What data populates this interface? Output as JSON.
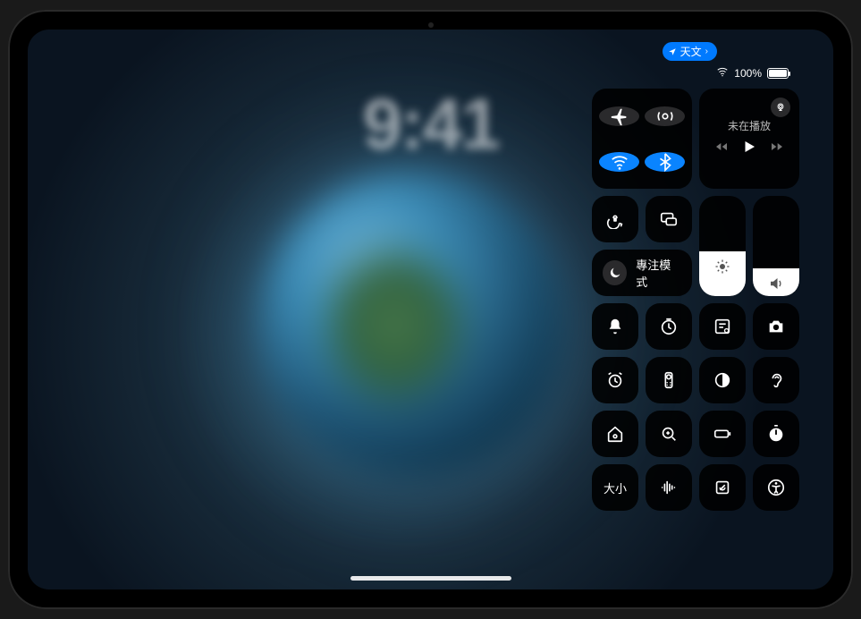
{
  "lock_screen": {
    "time": "9:41"
  },
  "status": {
    "pill_label": "天文",
    "battery_percent": "100%"
  },
  "control_center": {
    "media": {
      "title": "未在播放"
    },
    "focus": {
      "label": "專注模式"
    },
    "brightness_level": 0.45,
    "volume_level": 0.28,
    "text_size_label": "大小",
    "icons": {
      "airplane": "airplane-icon",
      "airdrop": "airdrop-icon",
      "wifi": "wifi-icon",
      "bluetooth": "bluetooth-icon",
      "airplay_audio": "airplay-audio-icon",
      "rewind": "rewind-icon",
      "play": "play-icon",
      "forward": "forward-icon",
      "orientation_lock": "orientation-lock-icon",
      "screen_mirroring": "screen-mirroring-icon",
      "moon": "moon-icon",
      "brightness": "brightness-icon",
      "volume": "volume-icon",
      "silent": "bell-icon",
      "timer": "timer-icon",
      "notes": "quick-note-icon",
      "camera": "camera-icon",
      "alarm": "alarm-icon",
      "remote": "apple-tv-remote-icon",
      "dark_mode": "dark-mode-icon",
      "hearing": "hearing-icon",
      "home": "home-icon",
      "magnifier": "magnifier-icon",
      "low_power": "battery-icon",
      "stopwatch": "stopwatch-icon",
      "text_size": "text-size-icon",
      "voice_memos": "voice-memos-icon",
      "shazam": "music-recognition-icon",
      "accessibility": "accessibility-icon"
    }
  }
}
